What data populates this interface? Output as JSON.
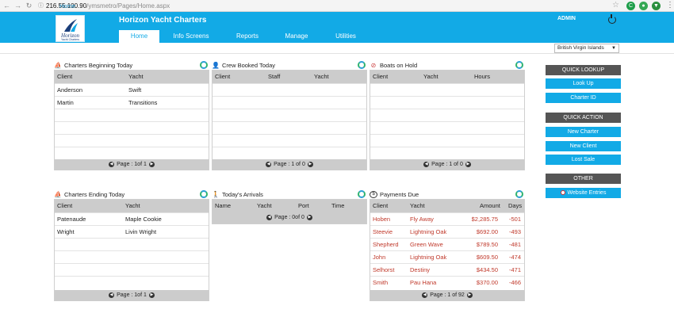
{
  "browser": {
    "url_domain": "216.55.100.90",
    "url_path": "/ymsmetro/Pages/Home.aspx"
  },
  "header": {
    "logo_text": "Horizon",
    "logo_sub": "Yacht Charters",
    "app_title": "Horizon Yacht Charters",
    "user": "ADMIN",
    "tabs": [
      {
        "label": "Home"
      },
      {
        "label": "Info Screens"
      },
      {
        "label": "Reports"
      },
      {
        "label": "Manage"
      },
      {
        "label": "Utilities"
      }
    ]
  },
  "breadcrumb": "Home",
  "region_select": {
    "value": "British Virgin Islands"
  },
  "panels": {
    "charters_begin": {
      "title": "Charters Beginning Today",
      "columns": [
        "Client",
        "Yacht"
      ],
      "rows": [
        [
          "Anderson",
          "Swift"
        ],
        [
          "Martin",
          "Transitions"
        ]
      ],
      "pager": "Page : 1of 1"
    },
    "crew_booked": {
      "title": "Crew Booked Today",
      "columns": [
        "Client",
        "Staff",
        "Yacht"
      ],
      "rows": [],
      "pager": "Page : 1 of 0"
    },
    "boats_hold": {
      "title": "Boats on Hold",
      "columns": [
        "Client",
        "Yacht",
        "Hours"
      ],
      "rows": [],
      "pager": "Page : 1 of 0"
    },
    "charters_end": {
      "title": "Charters Ending Today",
      "columns": [
        "Client",
        "Yacht"
      ],
      "rows": [
        [
          "Patenaude",
          "Maple Cookie"
        ],
        [
          "Wright",
          "Livin Wright"
        ]
      ],
      "pager": "Page : 1of 1"
    },
    "arrivals": {
      "title": "Today's Arrivals",
      "columns": [
        "Name",
        "Yacht",
        "Port",
        "Time"
      ],
      "rows": [],
      "pager": "Page : 0of 0"
    },
    "payments": {
      "title": "Payments Due",
      "columns": [
        "Client",
        "Yacht",
        "Amount",
        "Days"
      ],
      "rows": [
        [
          "Hoben",
          "Fly Away",
          "$2,285.75",
          "-501"
        ],
        [
          "Steevie",
          "Lightning Oak",
          "$692.00",
          "-493"
        ],
        [
          "Shepherd",
          "Green Wave",
          "$789.50",
          "-481"
        ],
        [
          "John",
          "Lightning Oak",
          "$609.50",
          "-474"
        ],
        [
          "Selhorst",
          "Destiny",
          "$434.50",
          "-471"
        ],
        [
          "Smith",
          "Pau Hana",
          "$370.00",
          "-466"
        ]
      ],
      "pager": "Page : 1 of 92"
    }
  },
  "sidebar": {
    "quick_lookup": {
      "title": "QUICK LOOKUP",
      "items": [
        "Look Up",
        "Charter ID"
      ]
    },
    "quick_action": {
      "title": "QUICK ACTION",
      "items": [
        "New Charter",
        "New Client",
        "Lost Sale"
      ]
    },
    "other": {
      "title": "OTHER",
      "items": [
        "Website Entries"
      ]
    }
  },
  "colors": {
    "brand_blue": "#12aae6",
    "header_gray": "#cccccc",
    "payment_red": "#c0392b",
    "side_head": "#555555"
  }
}
